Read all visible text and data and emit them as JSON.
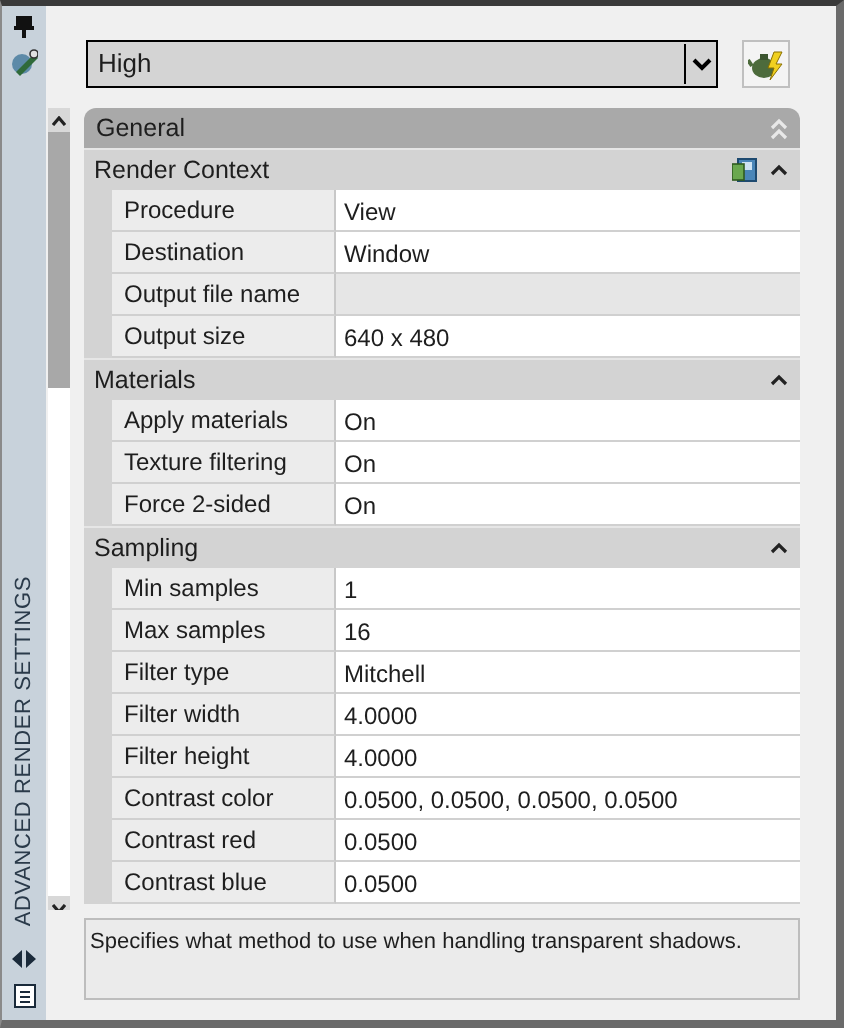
{
  "panel_title": "ADVANCED RENDER SETTINGS",
  "preset": {
    "value": "High"
  },
  "general": {
    "title": "General",
    "expanded": true
  },
  "sections": [
    {
      "title": "Render Context",
      "expanded": true,
      "tool_icon": true,
      "rows": [
        {
          "label": "Procedure",
          "value": "View",
          "disabled": false
        },
        {
          "label": "Destination",
          "value": "Window",
          "disabled": false
        },
        {
          "label": "Output file name",
          "disabled": true
        },
        {
          "label": "Output size",
          "value": "640 x 480",
          "disabled": false
        }
      ]
    },
    {
      "title": "Materials",
      "expanded": true,
      "tool_icon": false,
      "rows": [
        {
          "label": "Apply materials",
          "value": "On",
          "disabled": false
        },
        {
          "label": "Texture filtering",
          "value": "On",
          "disabled": false
        },
        {
          "label": "Force 2-sided",
          "value": "On",
          "disabled": false
        }
      ]
    },
    {
      "title": "Sampling",
      "expanded": true,
      "tool_icon": false,
      "rows": [
        {
          "label": "Min samples",
          "value": "1",
          "disabled": false
        },
        {
          "label": "Max samples",
          "value": "16",
          "disabled": false
        },
        {
          "label": "Filter type",
          "value": "Mitchell",
          "disabled": false
        },
        {
          "label": "Filter width",
          "value": "4.0000",
          "disabled": false
        },
        {
          "label": "Filter height",
          "value": "4.0000",
          "disabled": false
        },
        {
          "label": "Contrast color",
          "value": "0.0500, 0.0500, 0.0500, 0.0500",
          "disabled": false
        },
        {
          "label": "Contrast red",
          "value": "0.0500",
          "disabled": false
        },
        {
          "label": "Contrast blue",
          "value": "0.0500",
          "disabled": false
        }
      ]
    }
  ],
  "description": "Specifies what method to use when handling transparent shadows."
}
